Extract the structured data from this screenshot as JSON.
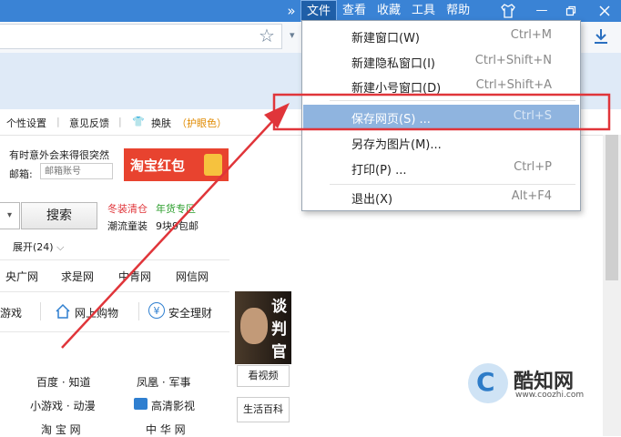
{
  "menubar": {
    "items": [
      "文件",
      "查看",
      "收藏",
      "工具",
      "帮助"
    ],
    "chevrons": "»"
  },
  "addressbar": {
    "star": "☆",
    "caret": "▾",
    "download": "⤓"
  },
  "toolbar2": {
    "settings": "个性设置",
    "feedback": "意见反馈",
    "skin": "换肤",
    "eye": "（护眼色）"
  },
  "left_panel": {
    "notice": "有时意外会来得很突然",
    "mail_label": "邮箱:",
    "mail_placeholder": "邮箱账号",
    "banner": "淘宝红包",
    "search_button": "搜索",
    "promo1": "冬装清仓",
    "promo2": "年货专区",
    "promo3": "潮流童装",
    "promo4": "9块9包邮",
    "expand": "展开(24)",
    "sites_row1": [
      "央广网",
      "求是网",
      "中青网",
      "网信网"
    ],
    "quick": [
      "游戏",
      "网上购物",
      "安全理财"
    ],
    "links": [
      [
        "百度 · 知道",
        "凤凰 · 军事"
      ],
      [
        "小游戏 · 动漫",
        "高清影视"
      ],
      [
        "淘 宝 网",
        "中 华 网"
      ]
    ]
  },
  "side_ad": {
    "poster_text": [
      "谈",
      "判",
      "官"
    ],
    "btn1": "看视频",
    "btn2": "生活百科"
  },
  "dropdown": {
    "items": [
      {
        "label": "新建窗口(W)",
        "shortcut": "Ctrl+M"
      },
      {
        "label": "新建隐私窗口(I)",
        "shortcut": "Ctrl+Shift+N"
      },
      {
        "label": "新建小号窗口(D)",
        "shortcut": "Ctrl+Shift+A"
      },
      {
        "label": "保存网页(S) ...",
        "shortcut": "Ctrl+S"
      },
      {
        "label": "另存为图片(M)...",
        "shortcut": ""
      },
      {
        "label": "打印(P) ...",
        "shortcut": "Ctrl+P"
      },
      {
        "label": "退出(X)",
        "shortcut": "Alt+F4"
      }
    ]
  },
  "watermark": {
    "title": "酷知网",
    "url": "www.coozhi.com",
    "logo": "C"
  },
  "colors": {
    "titlebar": "#3a83d5",
    "highlight": "#8fb4df",
    "annotation": "#e0353a",
    "promo_red": "#e0353a",
    "promo_green": "#2a9d2a",
    "banner": "#e8432f"
  }
}
